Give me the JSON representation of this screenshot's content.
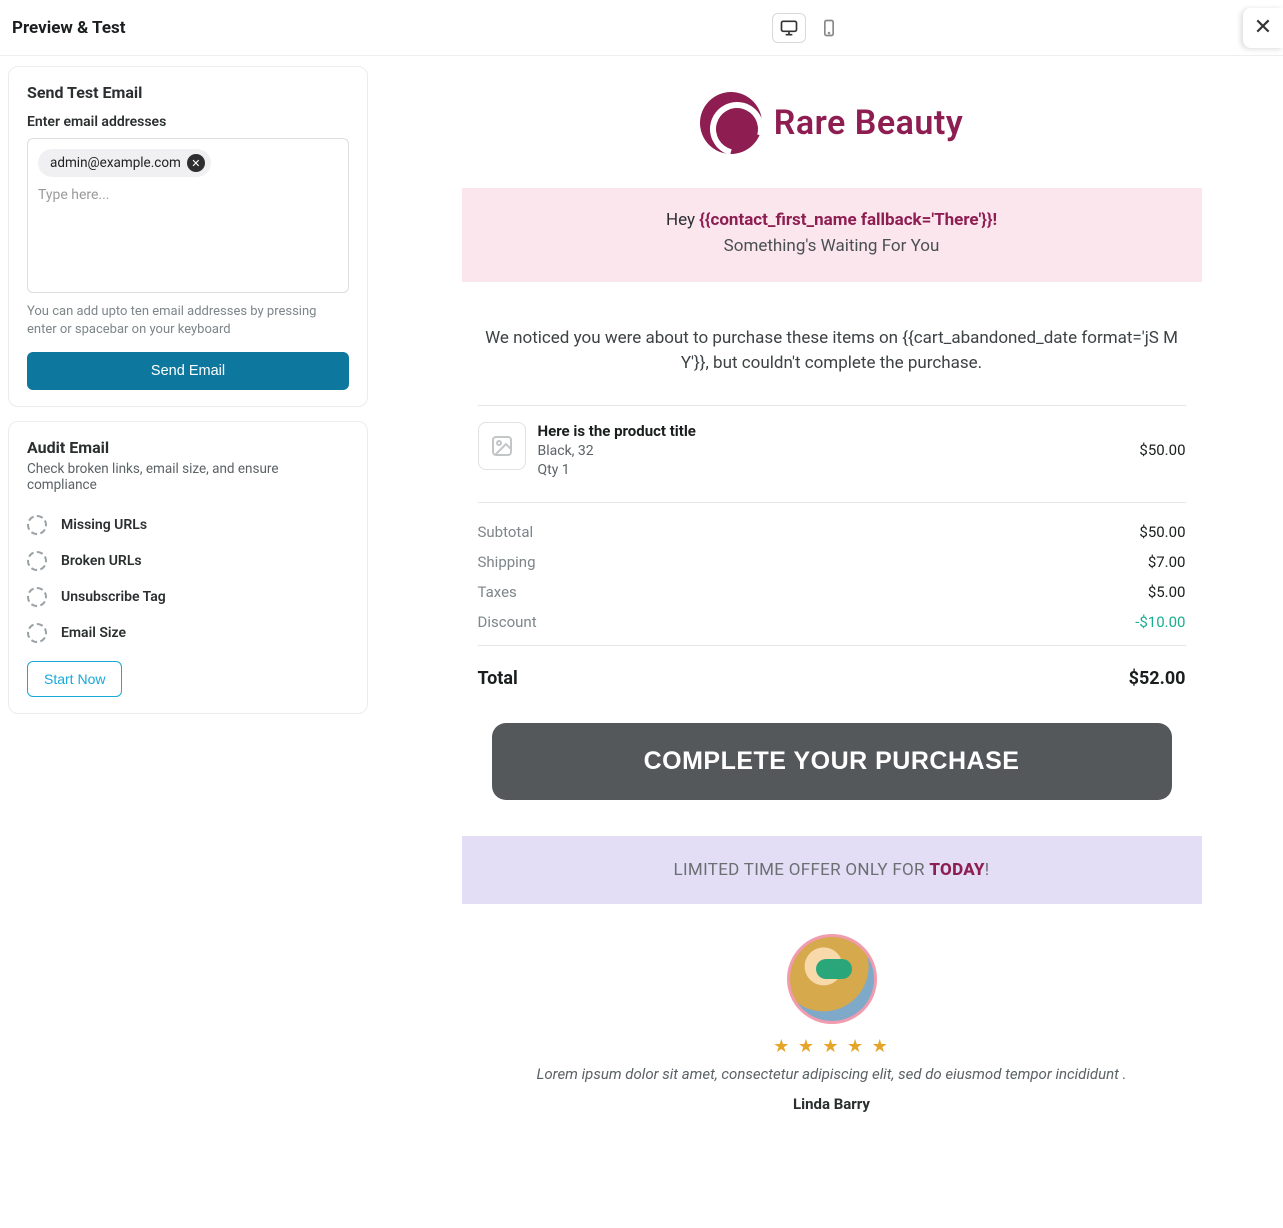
{
  "header": {
    "title": "Preview & Test"
  },
  "send_test": {
    "heading": "Send Test Email",
    "label": "Enter email addresses",
    "chip": "admin@example.com",
    "placeholder": "Type here...",
    "helper": "You can add upto ten email addresses by pressing enter or spacebar on your keyboard",
    "button": "Send Email"
  },
  "audit": {
    "heading": "Audit Email",
    "sub": "Check broken links, email size, and ensure compliance",
    "items": [
      "Missing URLs",
      "Broken URLs",
      "Unsubscribe Tag",
      "Email Size"
    ],
    "button": "Start Now"
  },
  "email": {
    "brand": "Rare Beauty",
    "hero_prefix": "Hey ",
    "hero_name": "{{contact_first_name fallback='There'}}!",
    "hero_sub": "Something's Waiting For You",
    "notice": "We noticed you were about to purchase these items on {{cart_abandoned_date format='jS M Y'}}, but couldn't complete the purchase.",
    "product": {
      "title": "Here is the product title",
      "variant": "Black, 32",
      "qty": "Qty 1",
      "price": "$50.00"
    },
    "totals": {
      "subtotal_label": "Subtotal",
      "subtotal": "$50.00",
      "shipping_label": "Shipping",
      "shipping": "$7.00",
      "taxes_label": "Taxes",
      "taxes": "$5.00",
      "discount_label": "Discount",
      "discount": "-$10.00",
      "total_label": "Total",
      "total": "$52.00"
    },
    "cta": "COMPLETE YOUR PURCHASE",
    "offer_prefix": "LIMITED TIME OFFER ONLY FOR ",
    "offer_today": "TODAY",
    "offer_suffix": "!",
    "testimonial": {
      "stars": "★ ★ ★ ★ ★",
      "text": "Lorem ipsum dolor sit amet, consectetur adipiscing elit, sed do eiusmod tempor incididunt .",
      "name": "Linda Barry"
    }
  }
}
